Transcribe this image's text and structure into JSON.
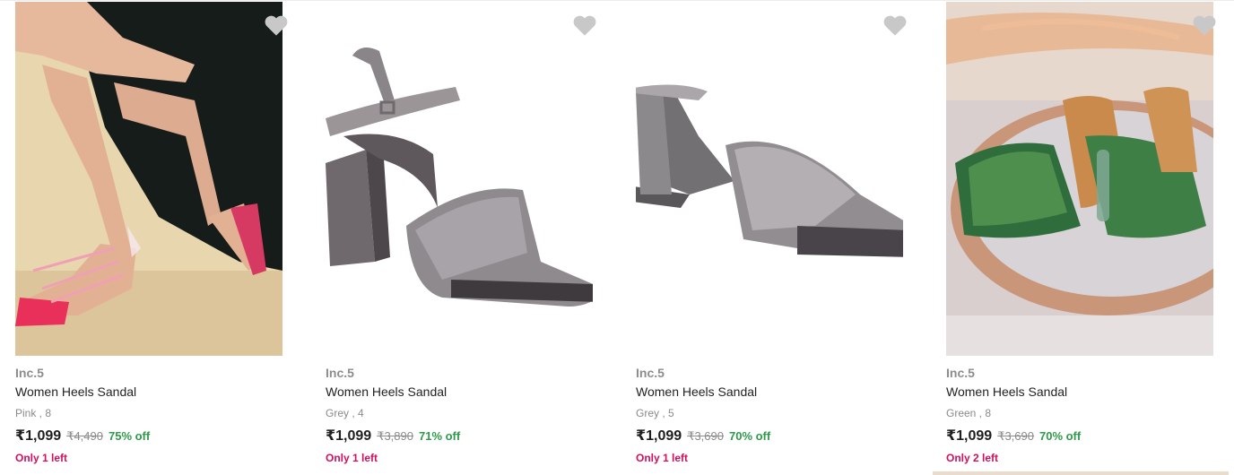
{
  "products": [
    {
      "brand": "Inc.5",
      "title": "Women Heels Sandal",
      "variant": "Pink , 8",
      "price": "₹1,099",
      "mrp": "₹4,490",
      "discount": "75% off",
      "stock": "Only 1 left",
      "image_icon": "pink-strappy-heel-photo",
      "wishlist_icon": "heart-icon"
    },
    {
      "brand": "Inc.5",
      "title": "Women Heels Sandal",
      "variant": "Grey , 4",
      "price": "₹1,099",
      "mrp": "₹3,890",
      "discount": "71% off",
      "stock": "Only 1 left",
      "image_icon": "grey-block-heel-sandal-photo",
      "wishlist_icon": "heart-icon"
    },
    {
      "brand": "Inc.5",
      "title": "Women Heels Sandal",
      "variant": "Grey , 5",
      "price": "₹1,099",
      "mrp": "₹3,690",
      "discount": "70% off",
      "stock": "Only 1 left",
      "image_icon": "grey-mule-heel-photo",
      "wishlist_icon": "heart-icon"
    },
    {
      "brand": "Inc.5",
      "title": "Women Heels Sandal",
      "variant": "Green , 8",
      "price": "₹1,099",
      "mrp": "₹3,690",
      "discount": "70% off",
      "stock": "Only 2 left",
      "image_icon": "green-glitter-mule-photo",
      "wishlist_icon": "heart-icon"
    }
  ],
  "colors": {
    "brand_text": "#8c8c8c",
    "discount": "#2e9a4a",
    "stock_warning": "#d0105e",
    "heart": "#c8c8c8"
  }
}
